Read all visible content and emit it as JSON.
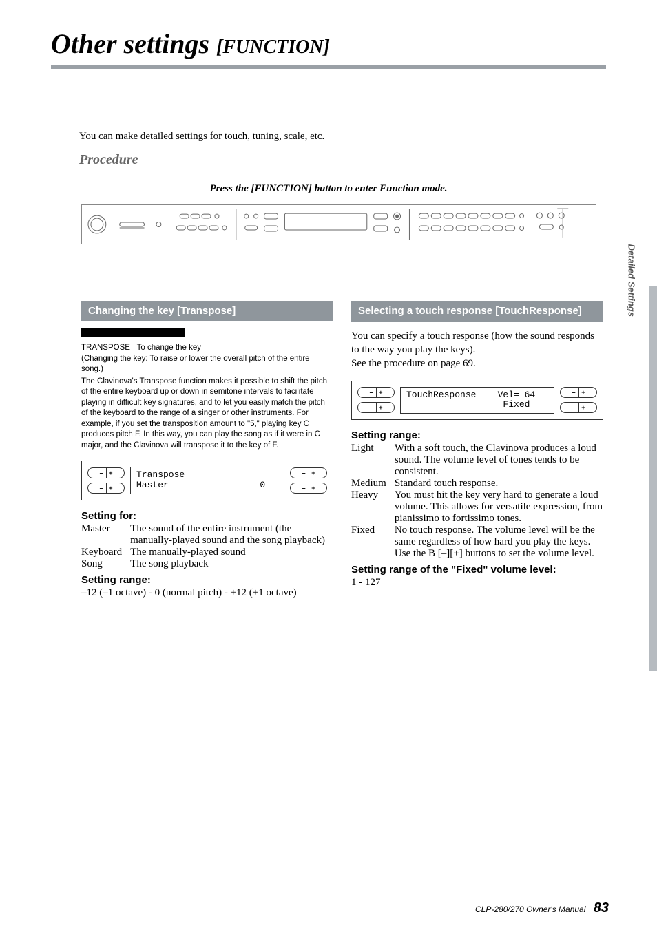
{
  "page": {
    "title_main": "Other settings",
    "title_sub": "[FUNCTION]",
    "intro": "You can make detailed settings for touch, tuning, scale, etc.",
    "procedure_label": "Procedure",
    "procedure_step": "Press the [FUNCTION] button to enter Function mode."
  },
  "left": {
    "heading": "Changing the key [Transpose]",
    "term1": "TRANSPOSE= To change the key",
    "term2": "(Changing the key: To raise or lower the overall pitch of the entire song.)",
    "para": "The Clavinova's Transpose function makes it possible to shift the pitch of the entire keyboard up or down in semitone intervals to facilitate playing in difficult key signatures, and to let you easily match the pitch of the keyboard to the range of a singer or other instruments. For example, if you set the transposition amount to \"5,\" playing key C produces pitch F. In this way, you can play the song as if it were in C major, and the Clavinova will transpose it to the key of F.",
    "lcd_line1": "Transpose",
    "lcd_line2": "Master                 0",
    "setting_for_label": "Setting for:",
    "rows": [
      {
        "term": "Master",
        "desc": "The sound of the entire instrument (the manually-played sound and the song playback)"
      },
      {
        "term": "Keyboard",
        "desc": "The manually-played sound"
      },
      {
        "term": "Song",
        "desc": "The song playback"
      }
    ],
    "setting_range_label": "Setting range:",
    "setting_range": "–12 (–1 octave) - 0 (normal pitch) - +12 (+1 octave)"
  },
  "right": {
    "heading": "Selecting a touch response [TouchResponse]",
    "para1": "You can specify a touch response (how the sound responds to the way you play the keys).",
    "para2": "See the procedure on page 69.",
    "lcd_line1": "TouchResponse    Vel= 64",
    "lcd_line2": "                  Fixed",
    "setting_range_label": "Setting range:",
    "rows": [
      {
        "term": "Light",
        "desc": "With a soft touch, the Clavinova produces a loud sound. The volume level of tones tends to be consistent."
      },
      {
        "term": "Medium",
        "desc": "Standard touch response."
      },
      {
        "term": "Heavy",
        "desc": "You must hit the key very hard to generate a loud volume. This allows for versatile expression, from pianissimo to fortissimo tones."
      },
      {
        "term": "Fixed",
        "desc": "No touch response. The volume level will be the same regardless of how hard you play the keys. Use the B [–][+] buttons to set the volume level."
      }
    ],
    "fixed_label": "Setting range of the \"Fixed\" volume level:",
    "fixed_range": "1 - 127"
  },
  "side": {
    "tab": "Detailed Settings"
  },
  "footer": {
    "manual": "CLP-280/270 Owner's Manual",
    "page": "83"
  },
  "btn": {
    "minus": "–",
    "plus": "+"
  }
}
